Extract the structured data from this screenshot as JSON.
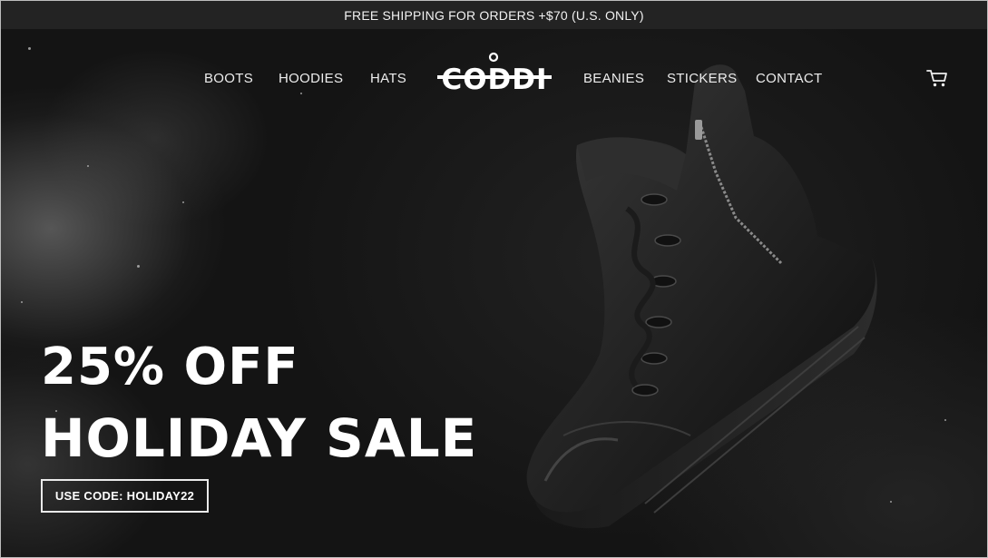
{
  "announcement": "FREE SHIPPING FOR ORDERS +$70 (U.S. ONLY)",
  "brand": "CÒDDI",
  "nav": {
    "left": [
      "BOOTS",
      "HOODIES",
      "HATS"
    ],
    "right": [
      "BEANIES",
      "STICKERS",
      "CONTACT"
    ]
  },
  "hero": {
    "headline_line1": "25% OFF",
    "headline_line2": "HOLIDAY SALE",
    "code_label": "USE CODE: HOLIDAY22"
  },
  "colors": {
    "background": "#141414",
    "announcement_bg": "#232323",
    "text": "#ffffff"
  },
  "icons": {
    "cart": "cart-icon"
  }
}
